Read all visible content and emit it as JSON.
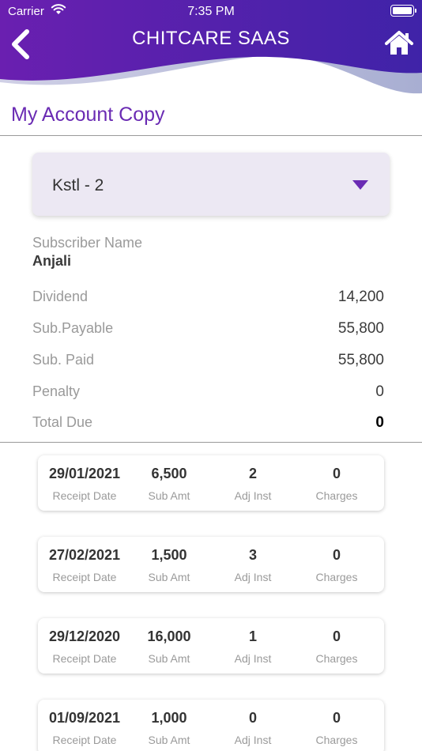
{
  "status_bar": {
    "carrier": "Carrier",
    "time": "7:35 PM"
  },
  "header": {
    "title": "CHITCARE SAAS"
  },
  "page": {
    "title": "My Account Copy"
  },
  "dropdown": {
    "selected": "Kstl - 2"
  },
  "subscriber": {
    "label": "Subscriber Name",
    "name": "Anjali"
  },
  "summary": [
    {
      "label": "Dividend",
      "value": "14,200"
    },
    {
      "label": "Sub.Payable",
      "value": "55,800"
    },
    {
      "label": "Sub. Paid",
      "value": "55,800"
    },
    {
      "label": "Penalty",
      "value": "0"
    },
    {
      "label": "Total Due",
      "value": "0"
    }
  ],
  "receipt_labels": {
    "date": "Receipt Date",
    "amount": "Sub Amt",
    "adj": "Adj Inst",
    "charges": "Charges"
  },
  "receipts": [
    {
      "date": "29/01/2021",
      "amount": "6,500",
      "adj": "2",
      "charges": "0"
    },
    {
      "date": "27/02/2021",
      "amount": "1,500",
      "adj": "3",
      "charges": "0"
    },
    {
      "date": "29/12/2020",
      "amount": "16,000",
      "adj": "1",
      "charges": "0"
    },
    {
      "date": "01/09/2021",
      "amount": "1,000",
      "adj": "0",
      "charges": "0"
    }
  ],
  "colors": {
    "header_start": "#6a1fb0",
    "header_end": "#3f23a8",
    "accent": "#6a2bb3",
    "wave": "#b8b8d8"
  }
}
